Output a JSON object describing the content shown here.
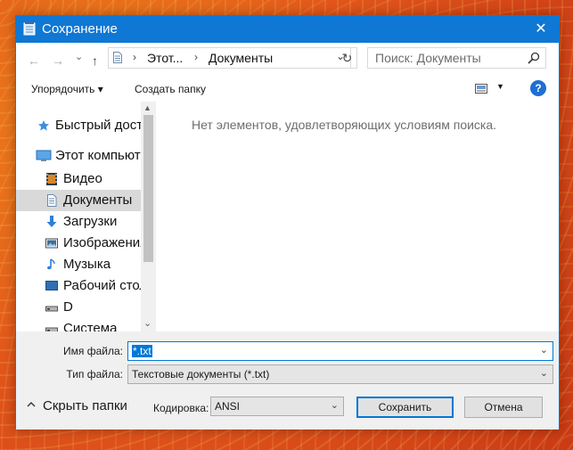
{
  "window": {
    "title": "Сохранение",
    "close_glyph": "✕"
  },
  "nav": {
    "back_glyph": "←",
    "forward_glyph": "→",
    "recent_glyph": "⌄",
    "up_glyph": "↑",
    "address": {
      "segments": [
        "Этот...",
        "Документы"
      ],
      "chevron": "›",
      "dropdown_glyph": "⌄"
    },
    "refresh_glyph": "↻",
    "search": {
      "placeholder": "Поиск: Документы",
      "icon": "search-icon"
    }
  },
  "toolbar": {
    "organize_label": "Упорядочить ▾",
    "new_folder_label": "Создать папку",
    "view_dd_glyph": "▼",
    "help_label": "?"
  },
  "sidebar": {
    "items": [
      {
        "label": "Быстрый доступ",
        "icon": "star-icon"
      },
      {
        "label": "Этот компьютер",
        "icon": "computer-icon"
      },
      {
        "label": "Видео",
        "icon": "video-icon"
      },
      {
        "label": "Документы",
        "icon": "document-icon",
        "selected": true
      },
      {
        "label": "Загрузки",
        "icon": "download-icon"
      },
      {
        "label": "Изображения",
        "icon": "pictures-icon"
      },
      {
        "label": "Музыка",
        "icon": "music-icon"
      },
      {
        "label": "Рабочий стол",
        "icon": "desktop-icon"
      },
      {
        "label": "D",
        "icon": "drive-icon"
      },
      {
        "label": "Система",
        "icon": "drive-icon"
      }
    ],
    "scroll_up_glyph": "▲",
    "scroll_down_glyph": "⌄"
  },
  "content": {
    "empty_message": "Нет элементов, удовлетворяющих условиям поиска."
  },
  "fields": {
    "filename_label": "Имя файла:",
    "filename_value": "*.txt",
    "filetype_label": "Тип файла:",
    "filetype_value": "Текстовые документы (*.txt)",
    "dropdown_glyph": "⌄"
  },
  "footer": {
    "hide_folders_label": "Скрыть папки",
    "encoding_label": "Кодировка:",
    "encoding_value": "ANSI",
    "save_label": "Сохранить",
    "cancel_label": "Отмена"
  },
  "colors": {
    "titlebar": "#0f77d4",
    "accent": "#0078d7",
    "selection": "#d9d9d9"
  }
}
